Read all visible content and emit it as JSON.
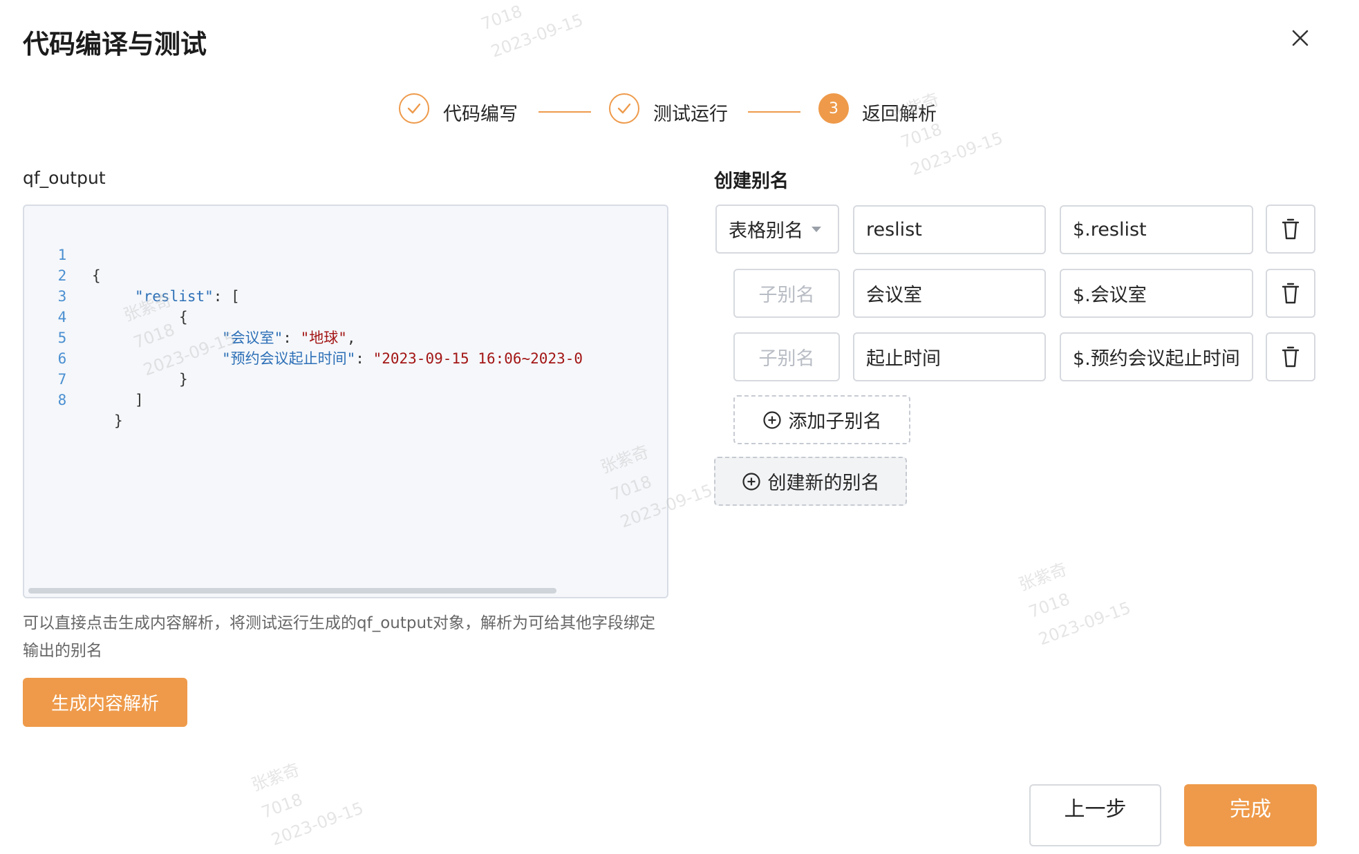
{
  "dialog": {
    "title": "代码编译与测试"
  },
  "steps": [
    {
      "label": "代码编写",
      "status": "done",
      "number": ""
    },
    {
      "label": "测试运行",
      "status": "done",
      "number": ""
    },
    {
      "label": "返回解析",
      "status": "active",
      "number": "3"
    }
  ],
  "left": {
    "label": "qf_output",
    "code_lines": [
      {
        "no": "1",
        "text": "{"
      },
      {
        "no": "2",
        "key": "\"reslist\"",
        "rest": ": ["
      },
      {
        "no": "3",
        "text": "{"
      },
      {
        "no": "4",
        "key": "\"会议室\"",
        "rest": ": ",
        "value": "\"地球\"",
        "tail": ","
      },
      {
        "no": "5",
        "key": "\"预约会议起止时间\"",
        "rest": ": ",
        "value": "\"2023-09-15 16:06~2023-0",
        "tail": ""
      },
      {
        "no": "6",
        "text": "}"
      },
      {
        "no": "7",
        "text": "]"
      },
      {
        "no": "8",
        "text": "}"
      }
    ],
    "hint": "可以直接点击生成内容解析，将测试运行生成的qf_output对象，解析为可给其他字段绑定输出的别名",
    "generate_button": "生成内容解析"
  },
  "right": {
    "title": "创建别名",
    "rows": [
      {
        "type": "表格别名",
        "name": "reslist",
        "path": "$.reslist"
      },
      {
        "type": "子别名",
        "name": "会议室",
        "path": "$.会议室"
      },
      {
        "type": "子别名",
        "name": "起止时间",
        "path": "$.预约会议起止时间"
      }
    ],
    "add_child_button": "添加子别名",
    "create_new_button": "创建新的别名"
  },
  "footer": {
    "prev_button": "上一步",
    "done_button": "完成"
  },
  "watermark": {
    "name": "张紫奇",
    "id": "7018",
    "date": "2023-09-15"
  },
  "colors": {
    "accent": "#ee9a4a",
    "json_key": "#2c6fb7",
    "json_string": "#a31515",
    "line_number": "#4a8fd1"
  }
}
